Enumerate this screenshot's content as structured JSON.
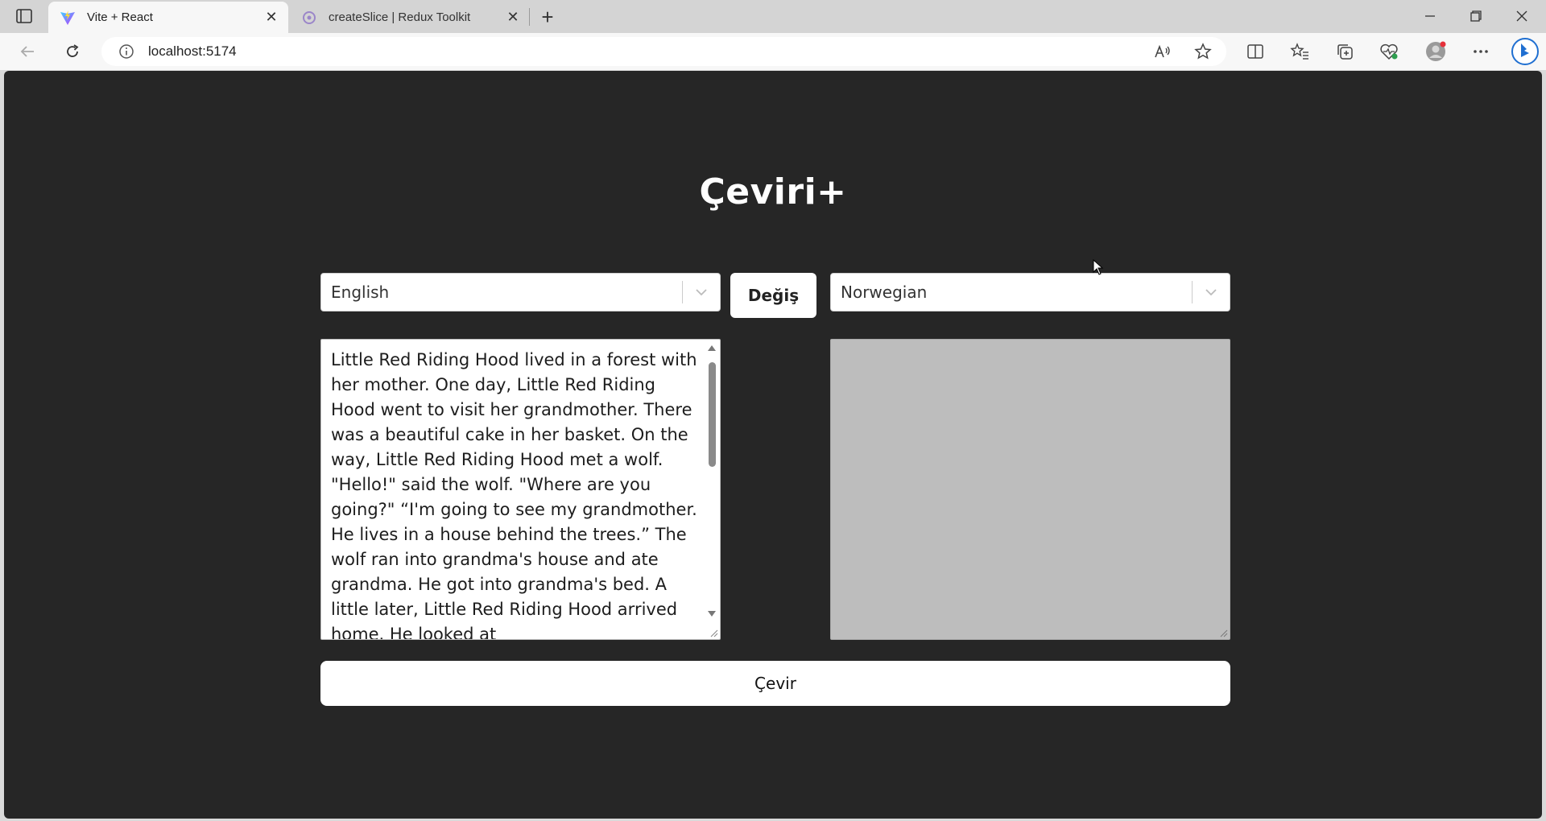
{
  "browser": {
    "tabs": [
      {
        "title": "Vite + React",
        "favicon": "vite-logo-icon",
        "active": true
      },
      {
        "title": "createSlice | Redux Toolkit",
        "favicon": "redux-logo-icon",
        "active": false
      }
    ],
    "address": "localhost:5174",
    "colors": {
      "tabbar": "#d4d4d4",
      "toolbar": "#f7f7f7"
    }
  },
  "app": {
    "title": "Çeviri+",
    "source_language": "English",
    "target_language": "Norwegian",
    "swap_label": "Değiş",
    "source_text": "Little Red Riding Hood lived in a forest with her mother. One day, Little Red Riding Hood went to visit her grandmother. There was a beautiful cake in her basket. On the way, Little Red Riding Hood met a wolf. \"Hello!\" said the wolf. \"Where are you going?\" “I'm going to see my grandmother. He lives in a house behind the trees.” The wolf ran into grandma's house and ate grandma. He got into grandma's bed. A little later, Little Red Riding Hood arrived home. He looked at",
    "target_text": "",
    "translate_label": "Çevir",
    "colors": {
      "background": "#262626",
      "output_box": "#bdbdbd",
      "title": "#ffffff"
    }
  }
}
